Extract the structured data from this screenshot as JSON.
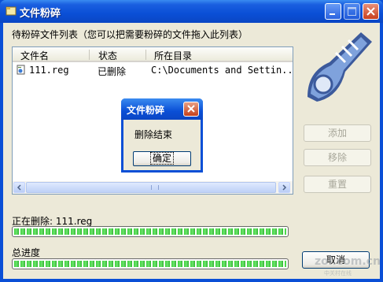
{
  "window": {
    "title": "文件粉碎"
  },
  "list": {
    "caption": "待粉碎文件列表（您可以把需要粉碎的文件拖入此列表）",
    "columns": [
      "文件名",
      "状态",
      "所在目录"
    ],
    "rows": [
      {
        "name": "111.reg",
        "status": "已删除",
        "dir": "C:\\Documents and Settin..."
      }
    ]
  },
  "side_buttons": {
    "add": "添加",
    "remove": "移除",
    "reset": "重置"
  },
  "progress": {
    "current_label": "正在删除: 111.reg",
    "current_percent": 100,
    "total_label": "总进度",
    "total_percent": 100
  },
  "cancel_label": "取消",
  "dialog": {
    "title": "文件粉碎",
    "message": "删除结束",
    "ok_label": "确定"
  },
  "watermark": {
    "text": "zol.com.cn",
    "sub": "中关村在线"
  },
  "colors": {
    "titlebar": "#0a4fd6",
    "face": "#ece9d8",
    "progress": "#3bd23b",
    "close": "#c8401e"
  }
}
